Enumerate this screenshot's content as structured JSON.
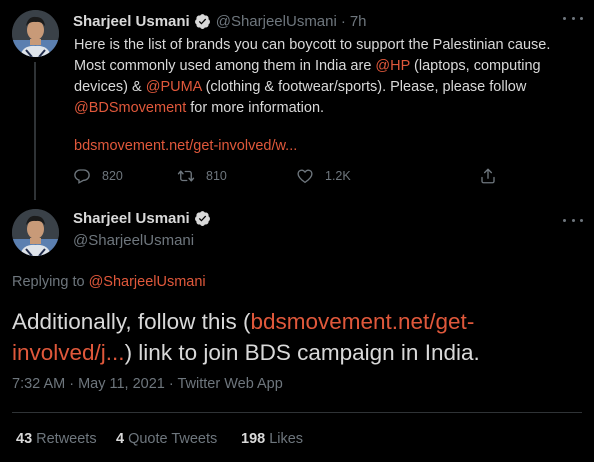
{
  "colors": {
    "background": "#000000",
    "text": "#d9d9d9",
    "muted": "#6e767d",
    "accent": "#e0583b",
    "divider": "#2f3336"
  },
  "top_tweet": {
    "name": "Sharjeel Usmani",
    "handle": "@SharjeelUsmani",
    "separator": "·",
    "time": "7h",
    "text_1": "Here is the list of brands you can boycott to support the Palestinian cause. Most commonly used among them in India are ",
    "mention_hp": "@HP",
    "text_2": " (laptops, computing devices) & ",
    "mention_puma": "@PUMA",
    "text_3": " (clothing & footwear/sports). Please, please follow ",
    "mention_bds": "@BDSmovement",
    "text_4": " for more information.",
    "link": "bdsmovement.net/get-involved/w...",
    "reply_count": "820",
    "retweet_count": "810",
    "like_count": "1.2K",
    "icons": [
      "reply-icon",
      "retweet-icon",
      "like-icon",
      "share-icon",
      "more-icon",
      "verified-icon"
    ]
  },
  "main_tweet": {
    "name": "Sharjeel Usmani",
    "handle": "@SharjeelUsmani",
    "replying_label": "Replying to ",
    "replying_handle": "@SharjeelUsmani",
    "text_1": "Additionally, follow this (",
    "link": "bdsmovement.net/get-involved/j...",
    "text_2": ") link to join BDS campaign in India.",
    "timestamp": "7:32 AM · May 11, 2021 · Twitter Web App",
    "retweets_count": "43",
    "retweets_label": "Retweets",
    "quotes_count": "4",
    "quotes_label": "Quote Tweets",
    "likes_count": "198",
    "likes_label": "Likes"
  }
}
